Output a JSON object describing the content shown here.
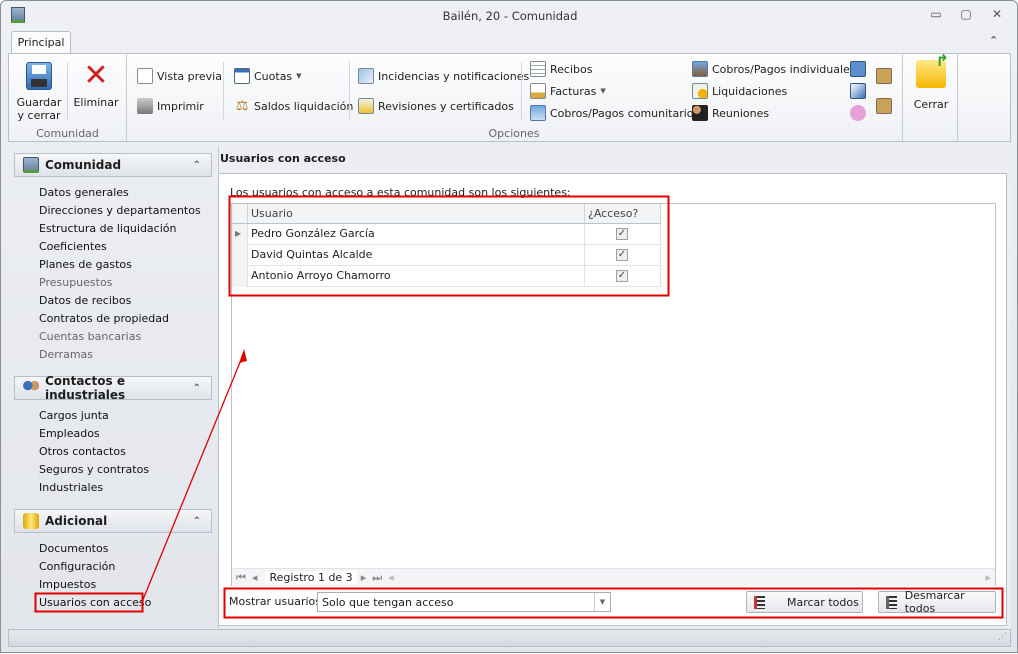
{
  "window": {
    "title": "Bailén, 20 - Comunidad",
    "minimize": "▭",
    "maximize": "▢",
    "close": "✕",
    "collapse_ribbon": "⌃"
  },
  "ribbon": {
    "tabs": [
      {
        "label": "Principal",
        "active": true
      }
    ],
    "groups": {
      "comunidad": {
        "label": "Comunidad",
        "buttons": [
          {
            "label": "Guardar\ny cerrar",
            "icon": "floppy-disk-icon"
          },
          {
            "label": "Eliminar",
            "icon": "red-x-icon"
          }
        ]
      },
      "opciones": {
        "label": "Opciones",
        "buttons": [
          {
            "label": "Vista previa",
            "icon": "preview-icon"
          },
          {
            "label": "Imprimir",
            "icon": "printer-icon"
          },
          {
            "label": "Cuotas",
            "icon": "calendar-icon",
            "dropdown": true
          },
          {
            "label": "Saldos liquidación",
            "icon": "scale-icon"
          },
          {
            "label": "Incidencias y notificaciones",
            "icon": "incidents-icon"
          },
          {
            "label": "Revisiones y certificados",
            "icon": "certificate-icon"
          },
          {
            "label": "Recibos",
            "icon": "receipt-icon"
          },
          {
            "label": "Facturas",
            "icon": "invoice-icon",
            "dropdown": true
          },
          {
            "label": "Cobros/Pagos comunitarios",
            "icon": "calculator-icon"
          },
          {
            "label": "Cobros/Pagos individuales",
            "icon": "person-calculator-icon"
          },
          {
            "label": "Liquidaciones",
            "icon": "settlement-icon"
          },
          {
            "label": "Reuniones",
            "icon": "meeting-icon"
          }
        ]
      },
      "cerrar": {
        "label": "Cerrar",
        "icon": "folder-exit-icon"
      }
    }
  },
  "sidebar": {
    "sections": [
      {
        "title": "Comunidad",
        "icon": "building-icon",
        "items": [
          {
            "label": "Datos generales",
            "enabled": true
          },
          {
            "label": "Direcciones y departamentos",
            "enabled": true
          },
          {
            "label": "Estructura de liquidación",
            "enabled": true
          },
          {
            "label": "Coeficientes",
            "enabled": true
          },
          {
            "label": "Planes de gastos",
            "enabled": true
          },
          {
            "label": "Presupuestos",
            "enabled": false
          },
          {
            "label": "Datos de recibos",
            "enabled": true
          },
          {
            "label": "Contratos de propiedad",
            "enabled": true
          },
          {
            "label": "Cuentas bancarias",
            "enabled": false
          },
          {
            "label": "Derramas",
            "enabled": false
          }
        ]
      },
      {
        "title": "Contactos e industriales",
        "icon": "people-icon",
        "items": [
          {
            "label": "Cargos junta"
          },
          {
            "label": "Empleados"
          },
          {
            "label": "Otros contactos"
          },
          {
            "label": "Seguros y contratos"
          },
          {
            "label": "Industriales"
          }
        ]
      },
      {
        "title": "Adicional",
        "icon": "database-icon",
        "items": [
          {
            "label": "Documentos"
          },
          {
            "label": "Configuración"
          },
          {
            "label": "Impuestos"
          },
          {
            "label": "Usuarios con acceso",
            "selected": true
          }
        ]
      }
    ]
  },
  "main": {
    "title": "Usuarios con acceso",
    "intro": "Los usuarios con acceso a esta comunidad son los siguientes:",
    "grid": {
      "columns": [
        "Usuario",
        "¿Acceso?"
      ],
      "rows": [
        {
          "usuario": "Pedro González García",
          "acceso": true,
          "current": true
        },
        {
          "usuario": "David Quintas Alcalde",
          "acceso": true
        },
        {
          "usuario": "Antonio Arroyo Chamorro",
          "acceso": true
        }
      ]
    },
    "navigator": {
      "text": "Registro 1 de 3"
    },
    "filter": {
      "label": "Mostrar usuarios:",
      "value": "Solo que tengan acceso"
    },
    "buttons": {
      "mark_all": "Marcar todos",
      "unmark_all": "Desmarcar todos"
    }
  },
  "annotations": {
    "color": "#e00000"
  }
}
